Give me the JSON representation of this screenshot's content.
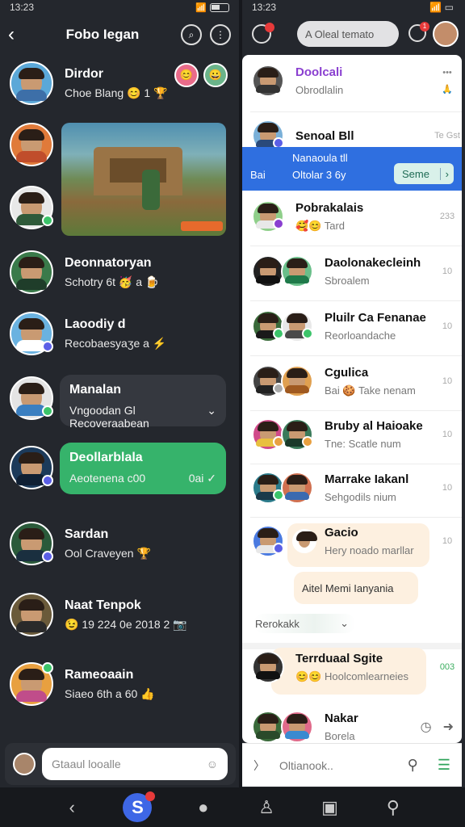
{
  "status": {
    "time": "13:23"
  },
  "left": {
    "title": "Fobo Iegan",
    "chats": [
      {
        "name": "Dirdor",
        "sub": "Choe Blang 😊 1 🏆"
      },
      {
        "name": "Deonnatoryan",
        "sub": "Schotry 6t 🥳 a 🍺"
      },
      {
        "name": "Laoodiy d",
        "sub": "Recobaesyaӡe a ⚡"
      },
      {
        "name": "Manalan",
        "sub": "Vngoodan Gl Recoveraabean",
        "chevron": "⌄"
      },
      {
        "name": "Deollarblala",
        "sub": "Aeotenena c00",
        "time": "0ai ✓"
      },
      {
        "name": "Sardan",
        "sub": "Ool Craveyen 🏆"
      },
      {
        "name": "Naat Tenpok",
        "sub": "😉 19  224 0e 2018 2 📷"
      },
      {
        "name": "Rameoaain",
        "sub": "Siaeo 6th a 60 👍"
      }
    ],
    "input_placeholder": "Gtaaul looalle"
  },
  "right": {
    "search_label": "A Oleal temato",
    "notif_count": "1",
    "items": [
      {
        "name": "Doolcali",
        "sub": "Obrodlalin",
        "right": "•••",
        "emoji": "🙏"
      },
      {
        "name": "Senoal Bll",
        "sub": "",
        "right": "Te Gst"
      },
      {
        "name": "Pobrakalais",
        "sub": "🥰😊 Tard",
        "right": "233"
      },
      {
        "name": "Daolonakecleinh",
        "sub": "Sbroalem",
        "right": "10"
      },
      {
        "name": "Pluilr Ca Fenanae",
        "sub": "Reorloandache",
        "right": "10"
      },
      {
        "name": "Cgulica",
        "sub": "Bai 🍪 Take nenam",
        "right": "10"
      },
      {
        "name": "Bruby al Haioake",
        "sub": "Tne: Scatle num",
        "right": "10"
      },
      {
        "name": "Marrake Iakanl",
        "sub": "Sehgodils nium",
        "right": "10"
      },
      {
        "name": "Gacio",
        "sub": "Hery noado marllar",
        "right": "10"
      },
      {
        "name": "Terrduaal Sgite",
        "sub": "😊😊 Hoolcomlearneies",
        "right": "003"
      },
      {
        "name": "Nakar",
        "sub": "Borela",
        "right": ""
      }
    ],
    "selected": {
      "line1": "Nanaoula tll",
      "line2": "Oltolar 3 6y",
      "prefix": "Bai",
      "button": "Seme"
    },
    "reply_bubble": "Aitel Memi Ianyania",
    "draft": "Rerokakk",
    "compose_placeholder": "Oltianook.."
  }
}
